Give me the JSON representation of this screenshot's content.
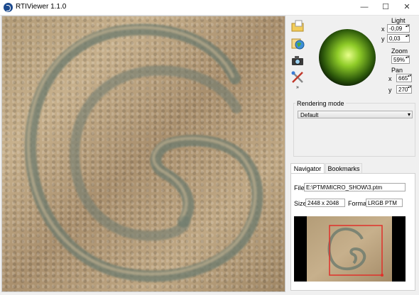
{
  "window": {
    "title": "RTIViewer 1.1.0",
    "controls": {
      "minimize": "—",
      "maximize": "☐",
      "close": "✕"
    }
  },
  "light": {
    "label": "Light",
    "x_label": "x",
    "x_value": "-0,09",
    "y_label": "y",
    "y_value": "0,03"
  },
  "zoom": {
    "label": "Zoom",
    "value": "59%"
  },
  "pan": {
    "label": "Pan",
    "x_label": "x",
    "x_value": "665",
    "y_label": "y",
    "y_value": "270"
  },
  "rendering": {
    "label": "Rendering mode",
    "selected": "Default"
  },
  "tabs": {
    "navigator": "Navigator",
    "bookmarks": "Bookmarks"
  },
  "navigator": {
    "file_label": "File",
    "file_value": "E:\\PTM\\MICRO_SHOW\\3.ptm",
    "size_label": "Size",
    "size_value": "2448 x 2048",
    "format_label": "Format",
    "format_value": "LRGB PTM"
  },
  "colors": {
    "light_sphere": "#8fcc28",
    "nav_rect": "#e0302a",
    "viewer_base": "#b29b77"
  },
  "icons": [
    "open-folder-icon",
    "globe-icon",
    "camera-icon",
    "tools-icon"
  ]
}
